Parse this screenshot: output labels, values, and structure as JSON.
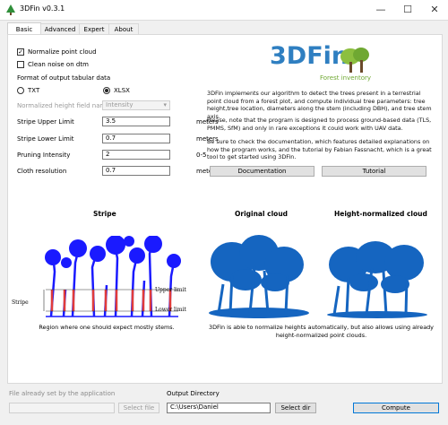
{
  "window": {
    "title": "3DFin v0.3.1",
    "minimize_glyph": "—",
    "maximize_glyph": "☐",
    "close_glyph": "✕"
  },
  "tabs": [
    {
      "label": "Basic"
    },
    {
      "label": "Advanced"
    },
    {
      "label": "Expert"
    },
    {
      "label": "About"
    }
  ],
  "options": {
    "normalize_label": "Normalize point cloud",
    "normalize_checked": true,
    "clean_noise_label": "Clean noise on dtm",
    "clean_noise_checked": false,
    "format_label": "Format of output tabular data",
    "txt_label": "TXT",
    "xlsx_label": "XLSX",
    "selected_format": "XLSX",
    "height_field_label": "Normalized height field name",
    "height_field_value": "Intensity"
  },
  "params": [
    {
      "label": "Stripe Upper Limit",
      "value": "3.5",
      "unit": "meters"
    },
    {
      "label": "Stripe Lower Limit",
      "value": "0.7",
      "unit": "meters"
    },
    {
      "label": "Pruning Intensity",
      "value": "2",
      "unit": "0-5"
    },
    {
      "label": "Cloth resolution",
      "value": "0.7",
      "unit": "meters"
    }
  ],
  "logo": {
    "text": "3DFin",
    "subtitle": "Forest inventory"
  },
  "description": {
    "p1": "3DFin implements our algorithm to detect the trees present in a terrestrial point cloud from a forest plot, and compute individual tree parameters: tree height,tree location, diameters along the stem (including DBH), and tree stem axis.",
    "p2": "Please, note that the program is designed to process ground-based data (TLS, PMMS, SfM) and only in rare exceptions it could work with UAV data.",
    "p3": "Be sure to check the documentation, which features detailed explanations on how the program works, and the tutorial by Fabian Fassnacht, which is a great tool to get started using 3DFin."
  },
  "links": {
    "documentation": "Documentation",
    "tutorial": "Tutorial"
  },
  "figures": {
    "stripe_title": "Stripe",
    "stripe_upper": "Upper limit",
    "stripe_lower": "Lower limit",
    "stripe_side": "Stripe",
    "stripe_caption": "Region where one should expect mostly stems.",
    "original_title": "Original cloud",
    "normalized_title": "Height-normalized cloud",
    "normalized_caption": "3DFin is able to normalize heights automatically, but also allows using already height-normalized point clouds."
  },
  "bottom": {
    "file_label": "File already set by the application",
    "file_value": "",
    "select_file": "Select file",
    "output_label": "Output Directory",
    "output_value": "C:\\Users\\Daniel",
    "select_dir": "Select dir",
    "compute": "Compute"
  },
  "colors": {
    "accent_blue": "#2f7fc1",
    "logo_green": "#8cbf3f",
    "point_blue": "#1565c0",
    "stripe_red": "#e03b3b",
    "stripe_blue": "#1a1aff"
  }
}
